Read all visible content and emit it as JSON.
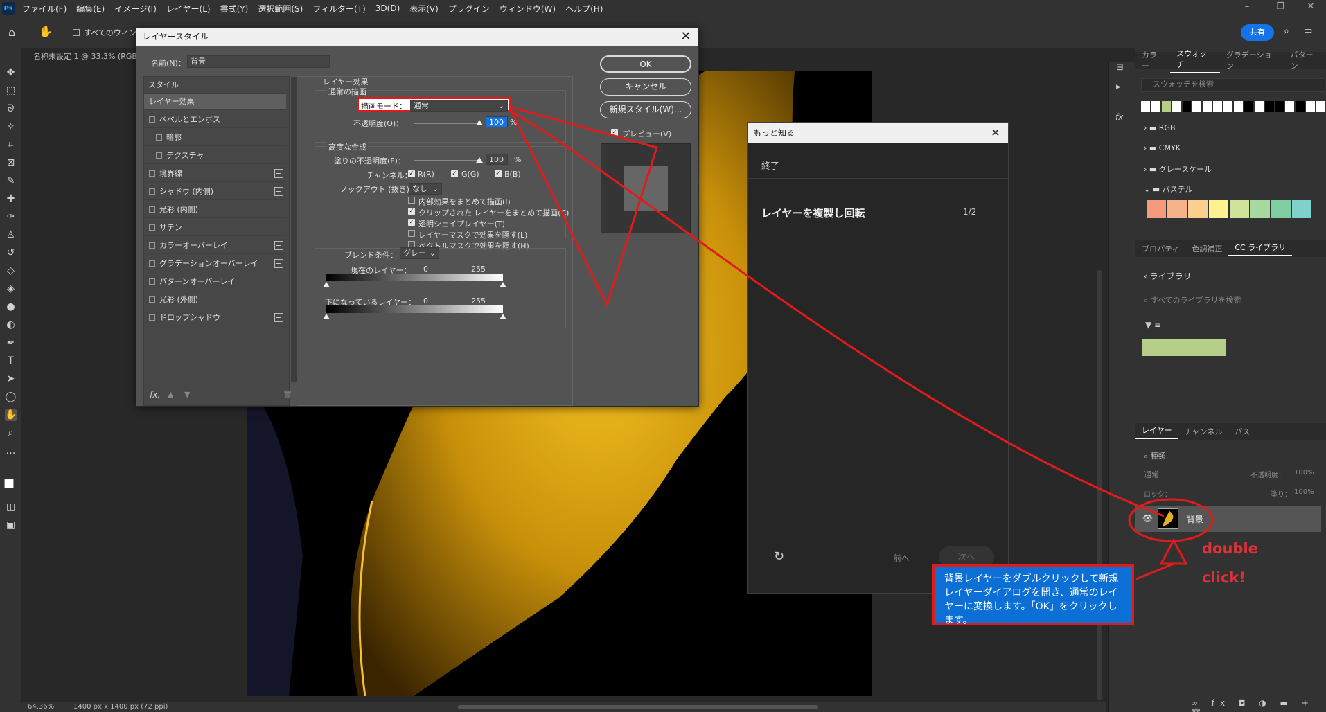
{
  "menubar": {
    "items": [
      "ファイル(F)",
      "編集(E)",
      "イメージ(I)",
      "レイヤー(L)",
      "書式(Y)",
      "選択範囲(S)",
      "フィルター(T)",
      "3D(D)",
      "表示(V)",
      "プラグイン",
      "ウィンドウ(W)",
      "ヘルプ(H)"
    ]
  },
  "options": {
    "all_windows": "すべてのウィンド"
  },
  "share_label": "共有",
  "doc_tab": "名称未設定 1 @ 33.3% (RGB",
  "status": {
    "zoom": "64.36%",
    "size": "1400 px x 1400 px (72 ppi)"
  },
  "dialog": {
    "title": "レイヤースタイル",
    "name_label": "名前(N)：",
    "name_value": "背景",
    "styles_header": "スタイル",
    "styles": [
      {
        "label": "レイヤー効果",
        "checkbox": false,
        "plus": false,
        "selected": true
      },
      {
        "label": "ベベルとエンボス",
        "checkbox": true,
        "plus": false
      },
      {
        "label": "輪郭",
        "checkbox": true,
        "plus": false,
        "indent": true
      },
      {
        "label": "テクスチャ",
        "checkbox": true,
        "plus": false,
        "indent": true
      },
      {
        "label": "境界線",
        "checkbox": true,
        "plus": true
      },
      {
        "label": "シャドウ (内側)",
        "checkbox": true,
        "plus": true
      },
      {
        "label": "光彩 (内側)",
        "checkbox": true,
        "plus": false
      },
      {
        "label": "サテン",
        "checkbox": true,
        "plus": false
      },
      {
        "label": "カラーオーバーレイ",
        "checkbox": true,
        "plus": true
      },
      {
        "label": "グラデーションオーバーレイ",
        "checkbox": true,
        "plus": true
      },
      {
        "label": "パターンオーバーレイ",
        "checkbox": true,
        "plus": false
      },
      {
        "label": "光彩 (外側)",
        "checkbox": true,
        "plus": false
      },
      {
        "label": "ドロップシャドウ",
        "checkbox": true,
        "plus": true
      }
    ],
    "footer_fx": "fx.",
    "effects_title": "レイヤー効果",
    "normal_blend": "通常の描画",
    "blend_mode_label": "描画モード：",
    "blend_mode_value": "通常",
    "opacity_label": "不透明度(O)：",
    "opacity_value": "100",
    "advanced_title": "高度な合成",
    "fill_label": "塗りの不透明度(F)：",
    "fill_value": "100",
    "percent": "%",
    "channel_label": "チャンネル：",
    "channels": [
      "R(R)",
      "G(G)",
      "B(B)"
    ],
    "knockout_label": "ノックアウト (抜き)：",
    "knockout_value": "なし",
    "adv_options": [
      {
        "label": "内部効果をまとめて描画(I)",
        "checked": false
      },
      {
        "label": "クリップされた レイヤーをまとめて描画(C)",
        "checked": true
      },
      {
        "label": "透明シェイプレイヤー(T)",
        "checked": true
      },
      {
        "label": "レイヤーマスクで効果を隠す(L)",
        "checked": false
      },
      {
        "label": "ベクトルマスクで効果を隠す(H)",
        "checked": false
      }
    ],
    "blendif_label": "ブレンド条件：",
    "blendif_value": "グレー",
    "current_layer": "現在のレイヤー：",
    "underlying_layer": "下になっているレイヤー：",
    "range_min": "0",
    "range_max": "255",
    "ok": "OK",
    "cancel": "キャンセル",
    "new_style": "新規スタイル(W)...",
    "preview": "プレビュー(V)"
  },
  "learn": {
    "title": "もっと知る",
    "done": "終了",
    "step_title": "レイヤーを複製し回転",
    "step_count": "1/2",
    "prev": "前へ",
    "next": "次へ"
  },
  "panels": {
    "top_tabs": [
      "カラー",
      "スウォッチ",
      "グラデーション",
      "パターン"
    ],
    "swatch_search": "スウォッチを検索",
    "swatch_groups": [
      "RGB",
      "CMYK",
      "グレースケール",
      "パステル"
    ],
    "pastel_colors": [
      "#f59a7a",
      "#f6b38a",
      "#fbd08f",
      "#fdf28f",
      "#cfe39a",
      "#a7d9a0",
      "#7fcfa2",
      "#7fd1cc"
    ],
    "mid_tabs": [
      "プロパティ",
      "色調補正",
      "CC ライブラリ"
    ],
    "libraries": "ライブラリ",
    "library_search": "すべてのライブラリを検索",
    "layer_tabs": [
      "レイヤー",
      "チャンネル",
      "パス"
    ],
    "kind_label": "種類",
    "mode": "通常",
    "opacity_label": "不透明度：",
    "opacity_value": "100%",
    "lock_label": "ロック：",
    "fill_label": "塗り：",
    "fill_value": "100%",
    "layer_name": "背景"
  },
  "annotations": {
    "callout": "背景レイヤーをダブルクリックして新規レイヤーダイアログを開き、通常のレイヤーに変換します。「OK」をクリックします。",
    "double": "double",
    "click": "click!"
  },
  "colors": {
    "accent": "#1473e6",
    "annot_red": "#e01b1b",
    "callout_blue": "#0c6fd6"
  }
}
